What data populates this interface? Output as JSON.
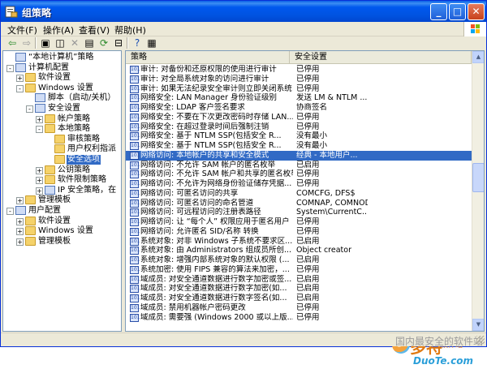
{
  "window": {
    "title": "组策略",
    "buttons": {
      "minimize": "_",
      "maximize": "□",
      "close": "✕"
    }
  },
  "menu": [
    "文件(F)",
    "操作(A)",
    "查看(V)",
    "帮助(H)"
  ],
  "toolbar": [
    "back-arrow-icon",
    "forward-arrow-icon",
    "up-folder-icon",
    "show-tree-icon",
    "delete-icon",
    "properties-icon",
    "refresh-icon",
    "export-icon",
    "help-icon",
    "console-icon"
  ],
  "tree": [
    {
      "label": "“本地计算机”策略",
      "level": 0,
      "expander": "",
      "icon": "policy"
    },
    {
      "label": "计算机配置",
      "level": 0,
      "expander": "-",
      "icon": "computer"
    },
    {
      "label": "软件设置",
      "level": 1,
      "expander": "+",
      "icon": "folder"
    },
    {
      "label": "Windows 设置",
      "level": 1,
      "expander": "-",
      "icon": "folder"
    },
    {
      "label": "脚本（启动/关机）",
      "level": 2,
      "expander": "",
      "icon": "script"
    },
    {
      "label": "安全设置",
      "level": 2,
      "expander": "-",
      "icon": "security"
    },
    {
      "label": "帐户策略",
      "level": 3,
      "expander": "+",
      "icon": "folder"
    },
    {
      "label": "本地策略",
      "level": 3,
      "expander": "-",
      "icon": "folder"
    },
    {
      "label": "审核策略",
      "level": 4,
      "expander": "",
      "icon": "folder"
    },
    {
      "label": "用户权利指派",
      "level": 4,
      "expander": "",
      "icon": "folder"
    },
    {
      "label": "安全选项",
      "level": 4,
      "expander": "",
      "icon": "folder",
      "selected": true
    },
    {
      "label": "公钥策略",
      "level": 3,
      "expander": "+",
      "icon": "folder"
    },
    {
      "label": "软件限制策略",
      "level": 3,
      "expander": "+",
      "icon": "folder"
    },
    {
      "label": "IP 安全策略，在",
      "level": 3,
      "expander": "+",
      "icon": "ipsec"
    },
    {
      "label": "管理模板",
      "level": 1,
      "expander": "+",
      "icon": "folder"
    },
    {
      "label": "用户配置",
      "level": 0,
      "expander": "-",
      "icon": "computer"
    },
    {
      "label": "软件设置",
      "level": 1,
      "expander": "+",
      "icon": "folder"
    },
    {
      "label": "Windows 设置",
      "level": 1,
      "expander": "+",
      "icon": "folder"
    },
    {
      "label": "管理模板",
      "level": 1,
      "expander": "+",
      "icon": "folder"
    }
  ],
  "list": {
    "columns": [
      "策略",
      "安全设置"
    ],
    "rows": [
      {
        "policy": "审计: 对备份和还原权限的使用进行审计",
        "setting": "已停用"
      },
      {
        "policy": "审计: 对全局系统对象的访问进行审计",
        "setting": "已停用"
      },
      {
        "policy": "审计: 如果无法纪录安全审计则立即关闭系统",
        "setting": "已停用"
      },
      {
        "policy": "网络安全: LAN Manager 身份验证级别",
        "setting": "发送 LM & NTLM ..."
      },
      {
        "policy": "网络安全: LDAP 客户签名要求",
        "setting": "协商签名"
      },
      {
        "policy": "网络安全: 不要在下次更改密码时存储 LAN...",
        "setting": "已停用"
      },
      {
        "policy": "网络安全: 在超过登录时间后强制注销",
        "setting": "已停用"
      },
      {
        "policy": "网络安全: 基于 NTLM SSP(包括安全 R...",
        "setting": "没有最小"
      },
      {
        "policy": "网络安全: 基于 NTLM SSP(包括安全 R...",
        "setting": "没有最小"
      },
      {
        "policy": "网络访问: 本地帐户的共享和安全模式",
        "setting": "经典 - 本地用户...",
        "selected": true
      },
      {
        "policy": "网络访问: 不允许 SAM 帐户的匿名枚举",
        "setting": "已启用"
      },
      {
        "policy": "网络访问: 不允许 SAM 帐户和共享的匿名枚举",
        "setting": "已停用"
      },
      {
        "policy": "网络访问: 不允许为网络身份验证储存凭据...",
        "setting": "已停用"
      },
      {
        "policy": "网络访问: 可匿名访问的共享",
        "setting": "COMCFG, DFS$"
      },
      {
        "policy": "网络访问: 可匿名访问的命名管道",
        "setting": "COMNAP, COMNODE,..."
      },
      {
        "policy": "网络访问: 可远程访问的注册表路径",
        "setting": "System\\CurrentC..."
      },
      {
        "policy": "网络访问: 让 “每个人” 权限应用于匿名用户",
        "setting": "已停用"
      },
      {
        "policy": "网络访问: 允许匿名 SID/名称 转换",
        "setting": "已停用"
      },
      {
        "policy": "系统对象: 对非 Windows 子系统不要求区...",
        "setting": "已启用"
      },
      {
        "policy": "系统对象: 由 Administrators 组成员所创...",
        "setting": "Object creator"
      },
      {
        "policy": "系统对象: 增强内部系统对象的默认权限 (...",
        "setting": "已启用"
      },
      {
        "policy": "系统加密: 使用 FIPS 兼容的算法来加密，...",
        "setting": "已停用"
      },
      {
        "policy": "域成员: 对安全通道数据进行数字加密或签...",
        "setting": "已启用"
      },
      {
        "policy": "域成员: 对安全通道数据进行数字加密(如...",
        "setting": "已启用"
      },
      {
        "policy": "域成员: 对安全通道数据进行数字签名(如...",
        "setting": "已启用"
      },
      {
        "policy": "域成员: 禁用机器帐户密码更改",
        "setting": "已停用"
      },
      {
        "policy": "域成员: 需要强 (Windows 2000 或以上版...",
        "setting": "已停用"
      }
    ]
  },
  "brand": {
    "main": "多特",
    "sub": "软件站",
    "url": "DuoTe.com"
  },
  "status": {
    "watermark": "国内最安全的软件站"
  }
}
